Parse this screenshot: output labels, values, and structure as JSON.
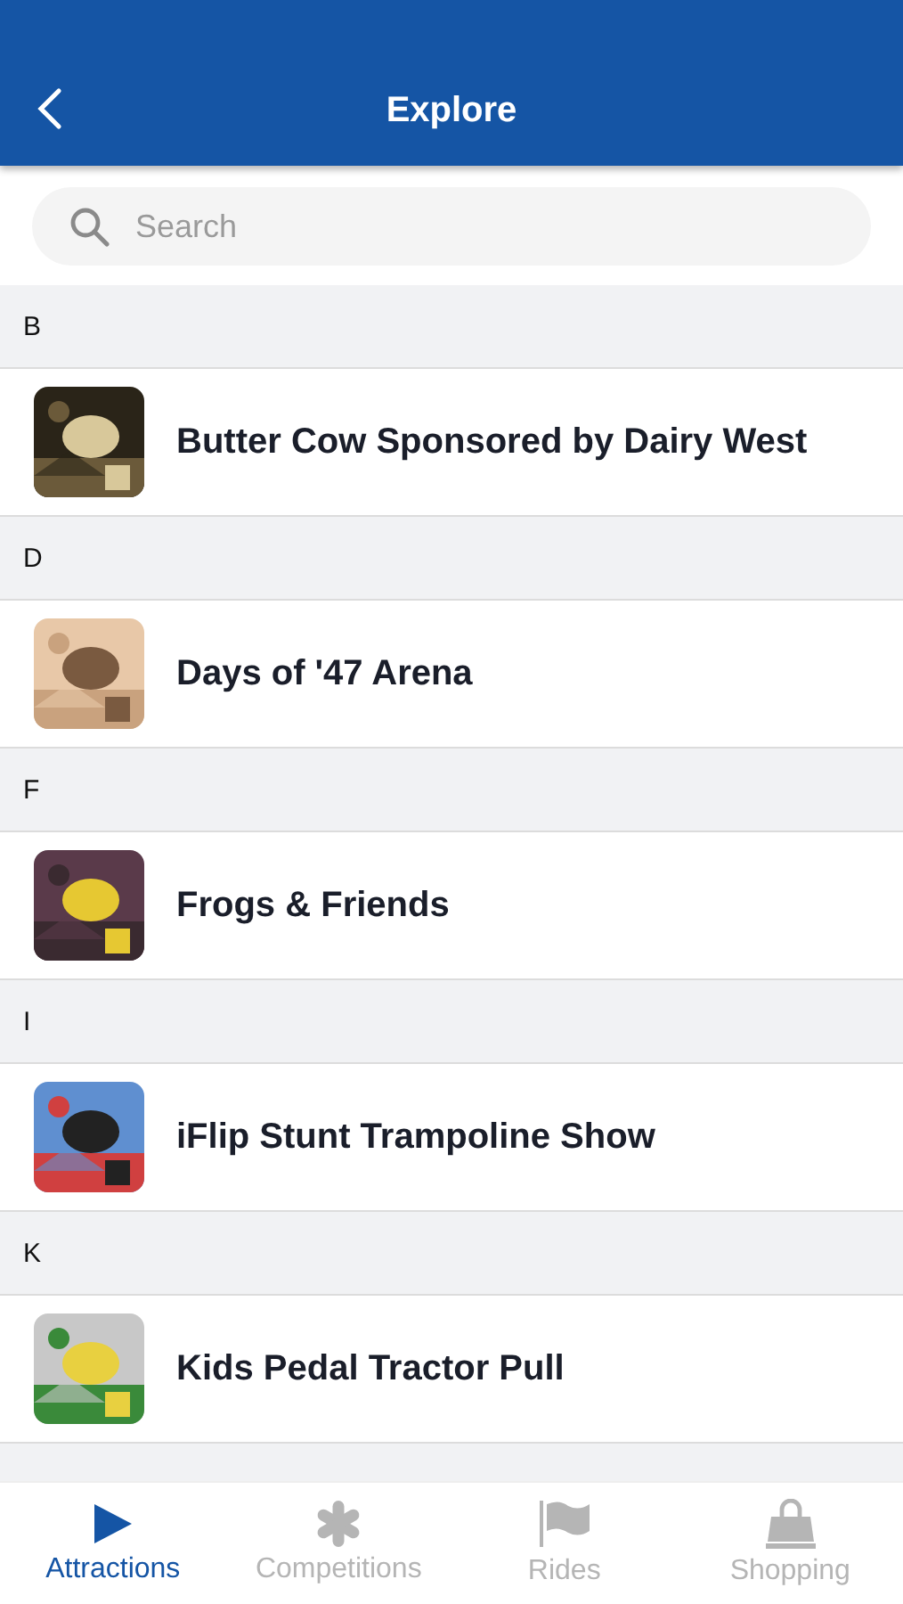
{
  "header": {
    "title": "Explore"
  },
  "search": {
    "placeholder": "Search"
  },
  "sections": [
    {
      "letter": "B",
      "items": [
        {
          "name": "Butter Cow Sponsored by Dairy West",
          "kind": "picture"
        }
      ]
    },
    {
      "letter": "D",
      "items": [
        {
          "name": "Days of '47 Arena",
          "kind": "picture"
        }
      ]
    },
    {
      "letter": "F",
      "items": [
        {
          "name": "Frogs & Friends",
          "kind": "picture"
        }
      ]
    },
    {
      "letter": "I",
      "items": [
        {
          "name": "iFlip Stunt Trampoline Show",
          "kind": "picture"
        }
      ]
    },
    {
      "letter": "K",
      "items": [
        {
          "name": "Kids Pedal Tractor Pull",
          "kind": "picture"
        }
      ]
    }
  ],
  "tabs": [
    {
      "label": "Attractions",
      "kind": "play",
      "selected": true
    },
    {
      "label": "Competitions",
      "kind": "asterisk",
      "selected": false
    },
    {
      "label": "Rides",
      "kind": "flag",
      "selected": false
    },
    {
      "label": "Shopping",
      "kind": "bag",
      "selected": false
    }
  ]
}
